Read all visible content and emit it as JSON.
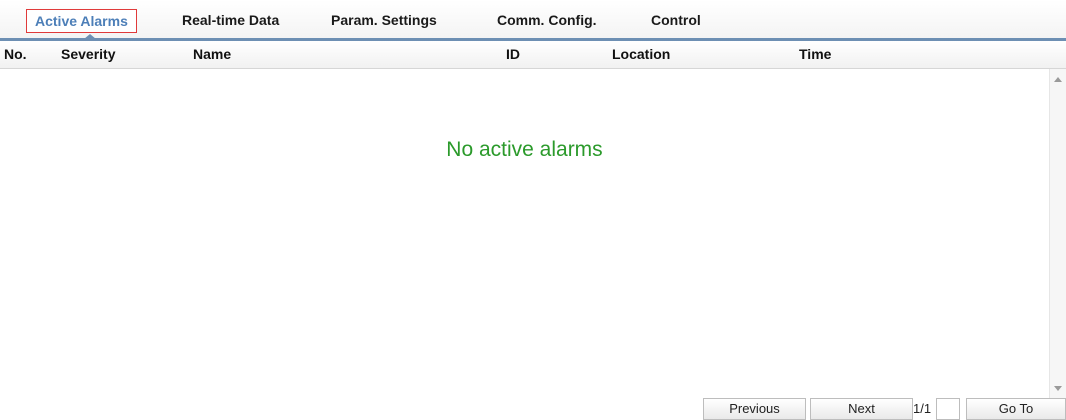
{
  "tabs": [
    {
      "label": "Active Alarms",
      "active": true
    },
    {
      "label": "Real-time Data",
      "active": false
    },
    {
      "label": "Param. Settings",
      "active": false
    },
    {
      "label": "Comm. Config.",
      "active": false
    },
    {
      "label": "Control",
      "active": false
    }
  ],
  "table": {
    "columns": [
      "No.",
      "Severity",
      "Name",
      "ID",
      "Location",
      "Time"
    ],
    "rows": [],
    "empty_message": "No active alarms"
  },
  "pager": {
    "previous_label": "Previous",
    "next_label": "Next",
    "page_indicator": "1/1",
    "page_input_value": "",
    "goto_label": "Go To"
  },
  "colors": {
    "accent": "#4d7fb8",
    "active_tab_border": "#e03a3a",
    "empty_message": "#2b9a2b",
    "tab_underline": "#6d8fb3"
  },
  "icons": [
    "scroll-up-icon",
    "scroll-down-icon",
    "tab-pointer-icon"
  ]
}
